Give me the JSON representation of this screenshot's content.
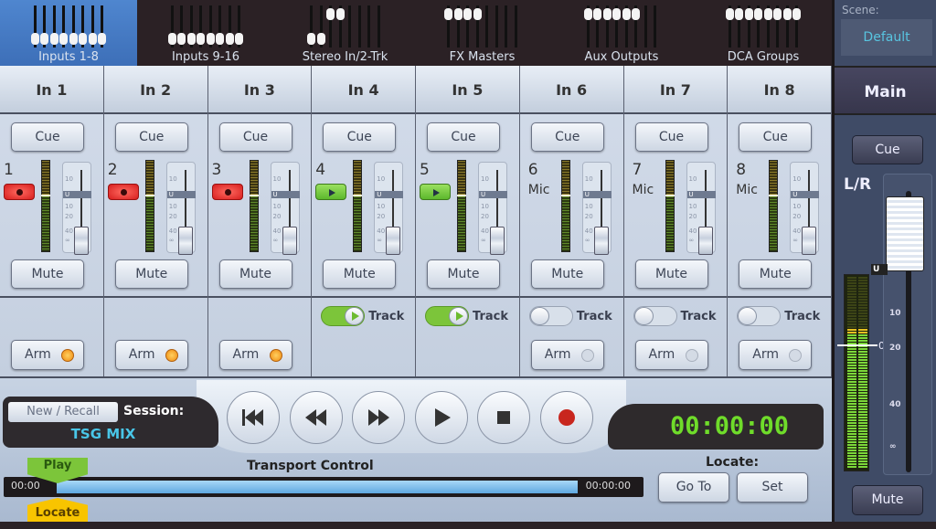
{
  "tabs": [
    {
      "label": "Inputs 1-8",
      "active": true,
      "knobs": [
        100,
        100,
        100,
        100,
        100,
        100,
        100,
        100
      ]
    },
    {
      "label": "Inputs 9-16",
      "active": false,
      "knobs": [
        100,
        100,
        100,
        100,
        100,
        100,
        100,
        100
      ]
    },
    {
      "label": "Stereo In/2-Trk",
      "active": false,
      "knobs": [
        100,
        100,
        30,
        30,
        null,
        null,
        null,
        null
      ]
    },
    {
      "label": "FX Masters",
      "active": false,
      "knobs": [
        30,
        30,
        30,
        30,
        null,
        null,
        null,
        null
      ]
    },
    {
      "label": "Aux Outputs",
      "active": false,
      "knobs": [
        30,
        30,
        30,
        30,
        30,
        30,
        null,
        null
      ]
    },
    {
      "label": "DCA Groups",
      "active": false,
      "knobs": [
        30,
        30,
        30,
        30,
        30,
        30,
        30,
        30
      ]
    }
  ],
  "channels": [
    {
      "name": "In 1",
      "number": "1",
      "source": "",
      "mode": "rec",
      "track": null,
      "arm": "lit",
      "fader_db": -45
    },
    {
      "name": "In 2",
      "number": "2",
      "source": "",
      "mode": "rec",
      "track": null,
      "arm": "lit",
      "fader_db": -45
    },
    {
      "name": "In 3",
      "number": "3",
      "source": "",
      "mode": "rec",
      "track": null,
      "arm": "lit",
      "fader_db": -45
    },
    {
      "name": "In 4",
      "number": "4",
      "source": "",
      "mode": "play",
      "track": "on",
      "arm": null,
      "fader_db": -45
    },
    {
      "name": "In 5",
      "number": "5",
      "source": "",
      "mode": "play",
      "track": "on",
      "arm": null,
      "fader_db": -45
    },
    {
      "name": "In 6",
      "number": "6",
      "source": "Mic",
      "mode": null,
      "track": "off",
      "arm": "unlit",
      "fader_db": -45
    },
    {
      "name": "In 7",
      "number": "7",
      "source": "Mic",
      "mode": null,
      "track": "off",
      "arm": "unlit",
      "fader_db": -45
    },
    {
      "name": "In 8",
      "number": "8",
      "source": "Mic",
      "mode": null,
      "track": "off",
      "arm": "unlit",
      "fader_db": -45
    }
  ],
  "labels": {
    "cue": "Cue",
    "mute": "Mute",
    "track": "Track",
    "arm": "Arm",
    "unity": "U"
  },
  "fader_scale": [
    "10",
    "10",
    "20",
    "40",
    "∞"
  ],
  "transport": {
    "new_recall": "New / Recall",
    "session_label": "Session:",
    "session_name": "TSG MIX",
    "buttons": [
      "return-to-zero",
      "rewind",
      "fast-forward",
      "play",
      "stop",
      "record"
    ],
    "timer": "00:00:00",
    "title": "Transport Control",
    "start_time": "00:00",
    "end_time": "00:00:00",
    "play_marker": "Play",
    "locate_marker": "Locate",
    "locate_label": "Locate:",
    "goto": "Go To",
    "set": "Set"
  },
  "main": {
    "scene_label": "Scene:",
    "scene": "Default",
    "title": "Main",
    "cue": "Cue",
    "bus": "L/R",
    "meter_zero": "0",
    "unity": "U",
    "scale": [
      "10",
      "10",
      "20",
      "40",
      "∞"
    ],
    "fader_db": 5,
    "mute": "Mute"
  },
  "colors": {
    "active_tab": "#4f86cf",
    "timer": "#6fdc2a",
    "session": "#49c6e8",
    "record": "#d71e1e",
    "play": "#7cc53a",
    "arm_lit": "#f08a10"
  }
}
